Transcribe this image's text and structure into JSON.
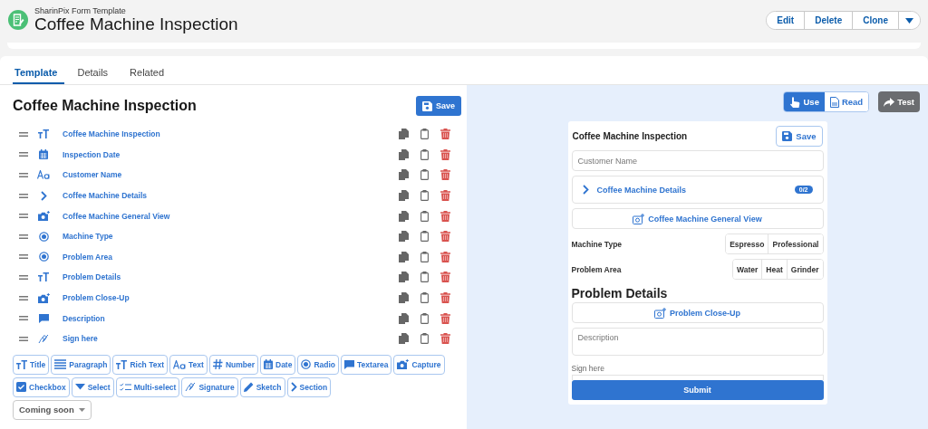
{
  "header": {
    "object_type": "SharinPix Form Template",
    "title": "Coffee Machine Inspection",
    "actions": [
      "Edit",
      "Delete",
      "Clone"
    ]
  },
  "tabs": [
    {
      "label": "Template",
      "selected": true
    },
    {
      "label": "Details",
      "selected": false
    },
    {
      "label": "Related",
      "selected": false
    }
  ],
  "editor": {
    "title": "Coffee Machine Inspection",
    "save": "Save",
    "fields": [
      {
        "kind": "title",
        "label": "Coffee Machine Inspection"
      },
      {
        "kind": "date",
        "label": "Inspection Date"
      },
      {
        "kind": "text",
        "label": "Customer Name"
      },
      {
        "kind": "section",
        "label": "Coffee Machine Details"
      },
      {
        "kind": "capture",
        "label": "Coffee Machine General View"
      },
      {
        "kind": "radio",
        "label": "Machine Type"
      },
      {
        "kind": "radio",
        "label": "Problem Area"
      },
      {
        "kind": "title",
        "label": "Problem Details"
      },
      {
        "kind": "capture",
        "label": "Problem Close-Up"
      },
      {
        "kind": "textarea",
        "label": "Description"
      },
      {
        "kind": "signature",
        "label": "Sign here"
      }
    ],
    "palette": [
      {
        "kind": "title",
        "label": "Title"
      },
      {
        "kind": "paragraph",
        "label": "Paragraph"
      },
      {
        "kind": "title",
        "label": "Rich Text"
      },
      {
        "kind": "text",
        "label": "Text"
      },
      {
        "kind": "number",
        "label": "Number"
      },
      {
        "kind": "date",
        "label": "Date"
      },
      {
        "kind": "radio",
        "label": "Radio"
      },
      {
        "kind": "textarea",
        "label": "Textarea"
      },
      {
        "kind": "capture",
        "label": "Capture"
      },
      {
        "kind": "checkbox",
        "label": "Checkbox"
      },
      {
        "kind": "select",
        "label": "Select"
      },
      {
        "kind": "multiselect",
        "label": "Multi-select"
      },
      {
        "kind": "signature",
        "label": "Signature"
      },
      {
        "kind": "sketch",
        "label": "Sketch"
      },
      {
        "kind": "section",
        "label": "Section"
      }
    ],
    "coming_soon": "Coming soon"
  },
  "preview": {
    "modes": [
      {
        "label": "Use",
        "selected": true
      },
      {
        "label": "Read",
        "selected": false
      }
    ],
    "test": "Test",
    "form": {
      "title": "Coffee Machine Inspection",
      "save": "Save",
      "items": [
        {
          "kind": "text",
          "placeholder": "Customer Name"
        },
        {
          "kind": "section",
          "label": "Coffee Machine Details",
          "badge": "0/2"
        },
        {
          "kind": "capture",
          "label": "Coffee Machine General View"
        },
        {
          "kind": "radio",
          "label": "Machine Type",
          "options": [
            "Espresso",
            "Professional"
          ]
        },
        {
          "kind": "radio",
          "label": "Problem Area",
          "options": [
            "Water",
            "Heat",
            "Grinder"
          ]
        },
        {
          "kind": "title",
          "label": "Problem Details"
        },
        {
          "kind": "capture",
          "label": "Problem Close-Up"
        },
        {
          "kind": "textarea",
          "placeholder": "Description"
        },
        {
          "kind": "signature",
          "label": "Sign here"
        }
      ],
      "submit": "Submit"
    }
  }
}
